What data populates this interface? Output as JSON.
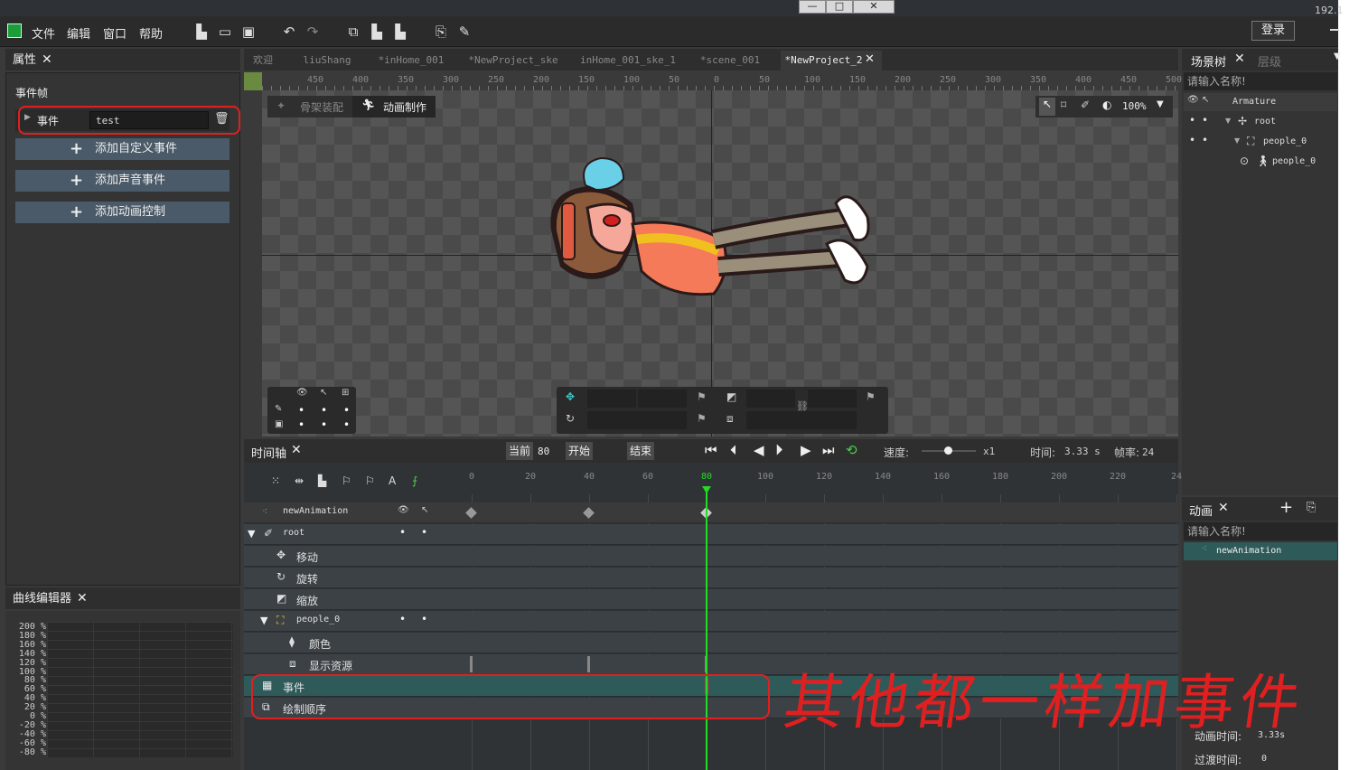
{
  "window": {
    "ip_fragment": "192.1",
    "minimize": "—",
    "maximize": "□",
    "close": "✕"
  },
  "menu": {
    "file": "文件",
    "edit": "编辑",
    "window": "窗口",
    "help": "帮助",
    "login": "登录"
  },
  "properties_panel": {
    "title": "属性",
    "section": "事件帧",
    "event_label": "事件",
    "event_value": "test",
    "add_custom": "添加自定义事件",
    "add_sound": "添加声音事件",
    "add_anim_ctrl": "添加动画控制"
  },
  "curve_editor": {
    "title": "曲线编辑器",
    "labels": [
      "200 %",
      "180 %",
      "160 %",
      "140 %",
      "120 %",
      "100 %",
      "80 %",
      "60 %",
      "40 %",
      "20 %",
      "0 %",
      "-20 %",
      "-40 %",
      "-60 %",
      "-80 %"
    ]
  },
  "tabs": [
    "欢迎",
    "liuShang",
    "*inHome_001",
    "*NewProject_ske",
    "inHome_001_ske_1",
    "*scene_001",
    "*NewProject_2"
  ],
  "ruler": [
    "450",
    "400",
    "350",
    "300",
    "250",
    "200",
    "150",
    "100",
    "50",
    "0",
    "50",
    "100",
    "150",
    "200",
    "250",
    "300",
    "350",
    "400",
    "450",
    "500"
  ],
  "viewport": {
    "mode_rig": "骨架装配",
    "mode_anim": "动画制作",
    "zoom": "100%"
  },
  "timeline": {
    "title": "时间轴",
    "current_label": "当前",
    "current_value": "80",
    "start_label": "开始",
    "end_label": "结束",
    "speed_label": "速度:",
    "speed_value": "x1",
    "time_label": "时间:",
    "time_value": "3.33 s",
    "fps_label": "帧率:",
    "fps_value": "24",
    "frame_ticks": [
      "0",
      "20",
      "40",
      "60",
      "80",
      "100",
      "120",
      "140",
      "160",
      "180",
      "200",
      "220",
      "24"
    ],
    "rows": {
      "animation": "newAnimation",
      "root": "root",
      "move": "移动",
      "rotate": "旋转",
      "scale": "缩放",
      "people": "people_0",
      "color": "颜色",
      "display": "显示资源",
      "event": "事件",
      "draw_order": "绘制顺序"
    }
  },
  "scene_tree": {
    "title": "场景树",
    "tab2": "层级",
    "placeholder": "请输入名称!",
    "armature": "Armature",
    "root": "root",
    "people_bone": "people_0",
    "people_display": "people_0"
  },
  "animation_panel": {
    "title": "动画",
    "placeholder": "请输入名称!",
    "item": "newAnimation",
    "anim_time_label": "动画时间:",
    "anim_time_value": "3.33s",
    "transition_label": "过渡时间:",
    "transition_value": "0"
  },
  "annotation": {
    "handwriting": "其他都一样加事件"
  },
  "colors": {
    "accent_green": "#22dd22",
    "annotation_red": "#e02020",
    "selected_row": "#2e5a5a"
  }
}
